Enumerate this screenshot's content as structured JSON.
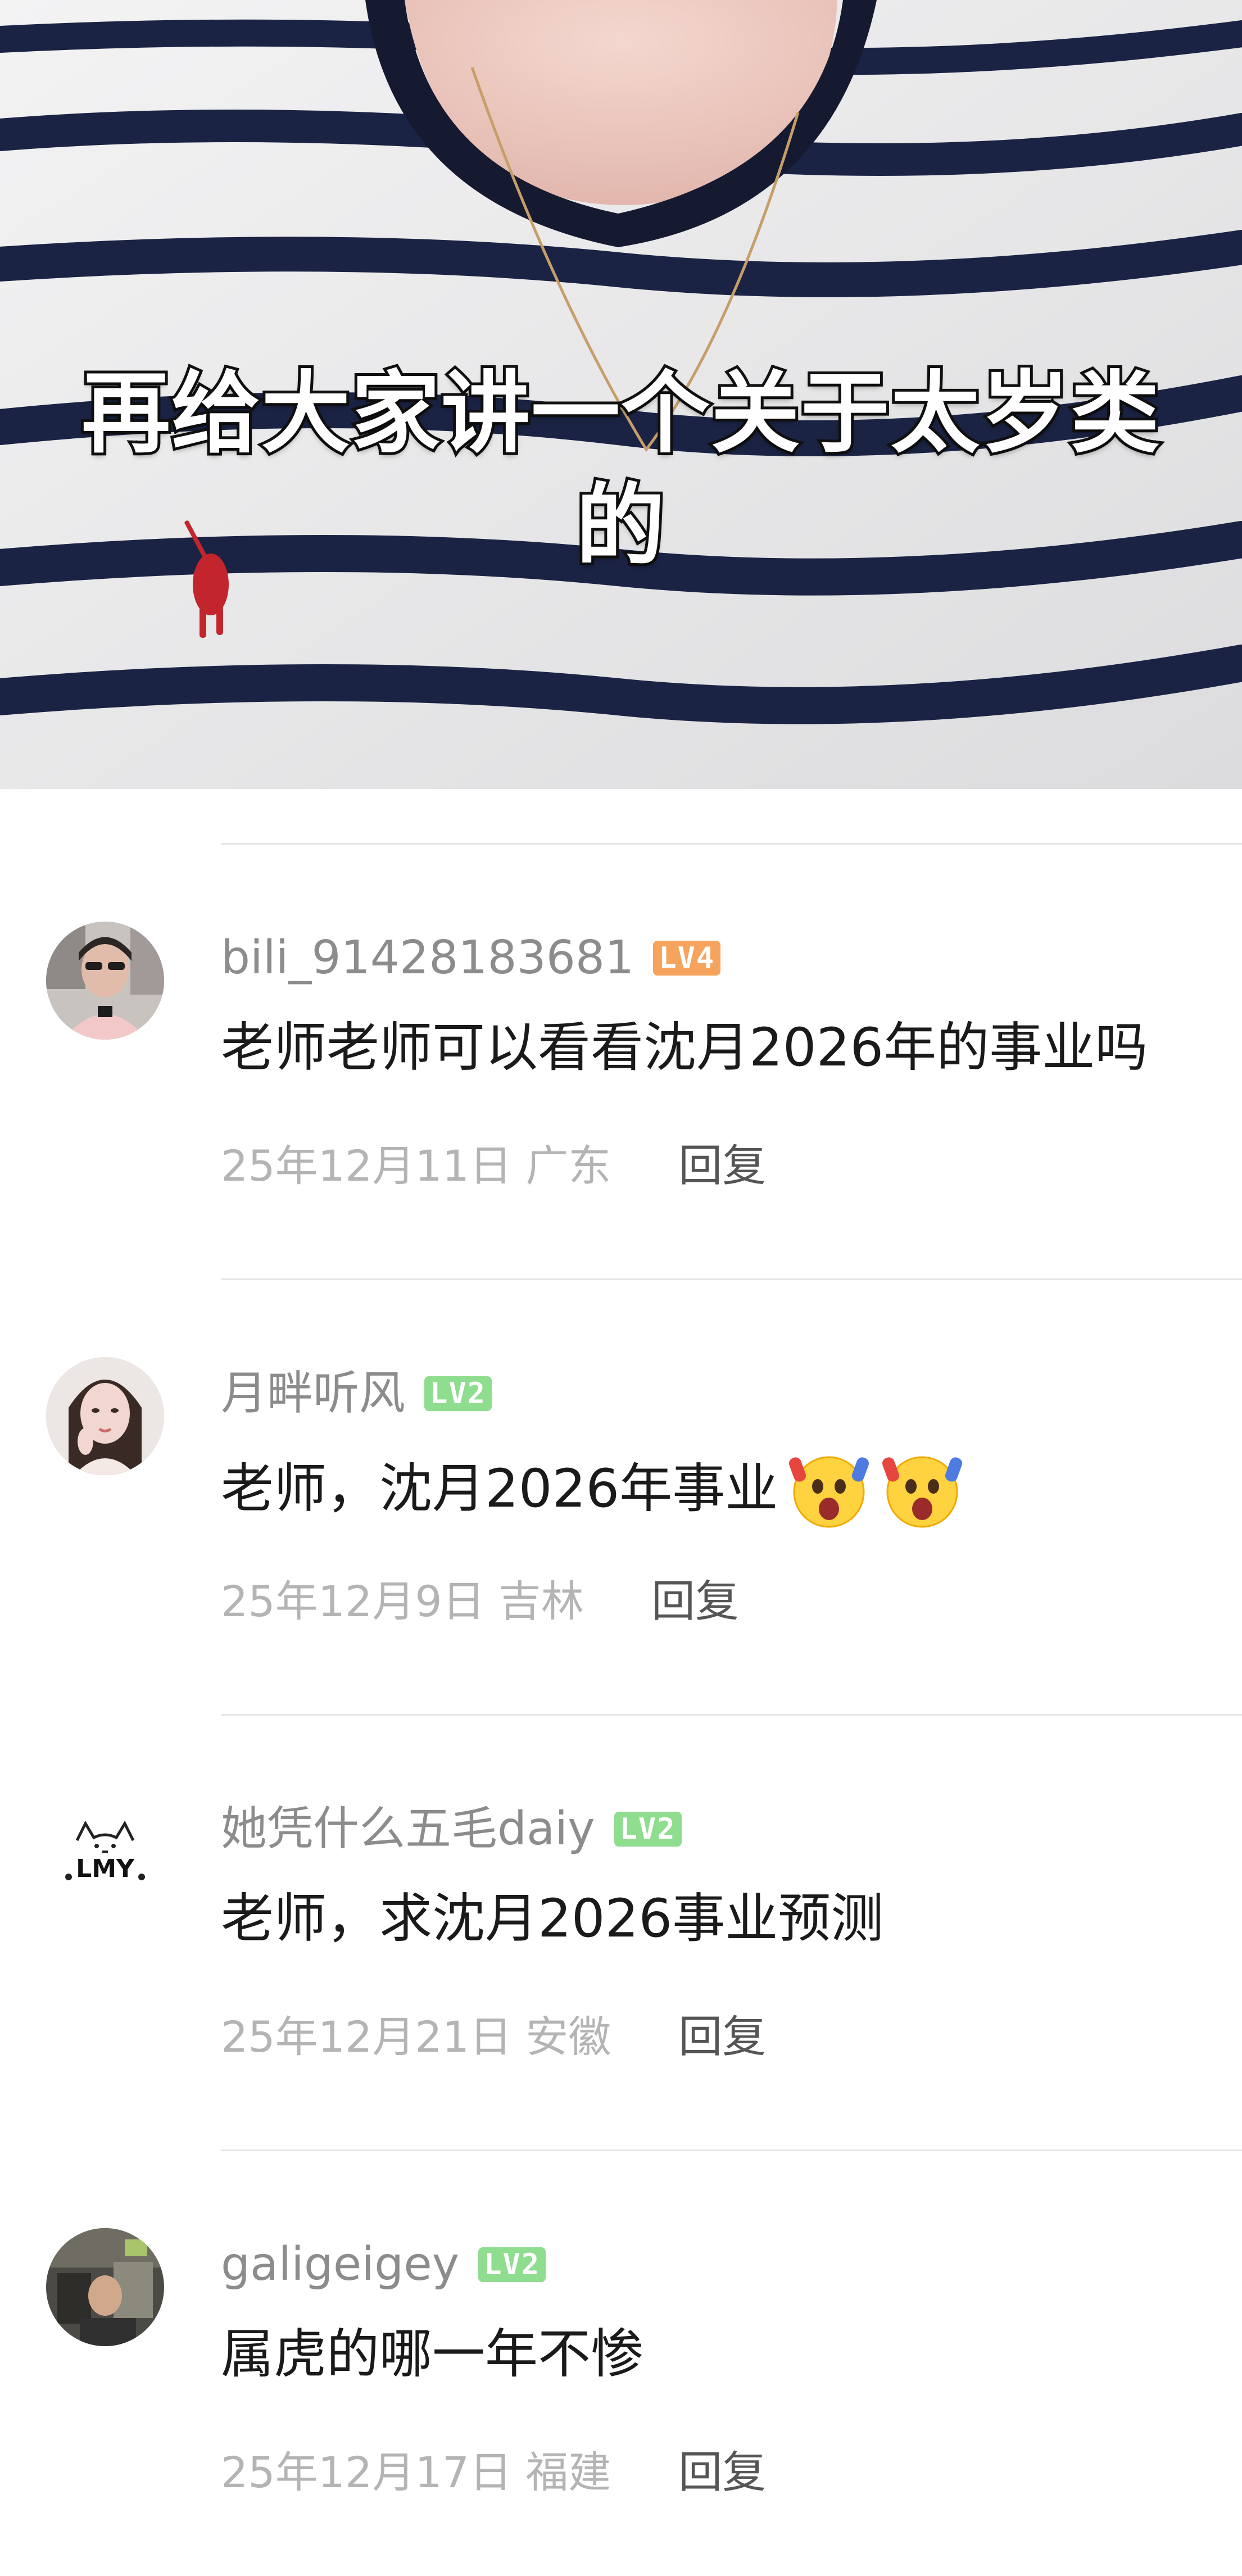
{
  "video": {
    "subtitle_line1": "再给大家讲一个关于太岁类",
    "subtitle_line2": "的"
  },
  "colors": {
    "level_lv4": "#f5a35d",
    "level_lv2": "#8fdd8e",
    "username": "#8c8c8c",
    "date": "#b4b4b4",
    "reply": "#555555",
    "stripe": "#1b2344"
  },
  "comments": [
    {
      "username": "bili_91428183681",
      "level": "LV4",
      "text": "老师老师可以看看沈月2026年的事业吗",
      "emojis": [],
      "date_location": "25年12月11日 广东",
      "reply_label": "回复",
      "avatar": "avatar-photo-man"
    },
    {
      "username": "月畔听风",
      "level": "LV2",
      "text": "老师，沈月2026年事业",
      "emojis": [
        "scared-face-emoji",
        "scared-face-emoji"
      ],
      "date_location": "25年12月9日 吉林",
      "reply_label": "回复",
      "avatar": "avatar-photo-woman"
    },
    {
      "username": "她凭什么五毛daiy",
      "level": "LV2",
      "text": "老师，求沈月2026事业预测",
      "emojis": [],
      "date_location": "25年12月21日 安徽",
      "reply_label": "回复",
      "avatar": "avatar-cat-doodle",
      "avatar_text": "LMY"
    },
    {
      "username": "galigeigey",
      "level": "LV2",
      "text": "属虎的哪一年不惨",
      "emojis": [],
      "date_location": "25年12月17日 福建",
      "reply_label": "回复",
      "avatar": "avatar-photo-room"
    }
  ]
}
